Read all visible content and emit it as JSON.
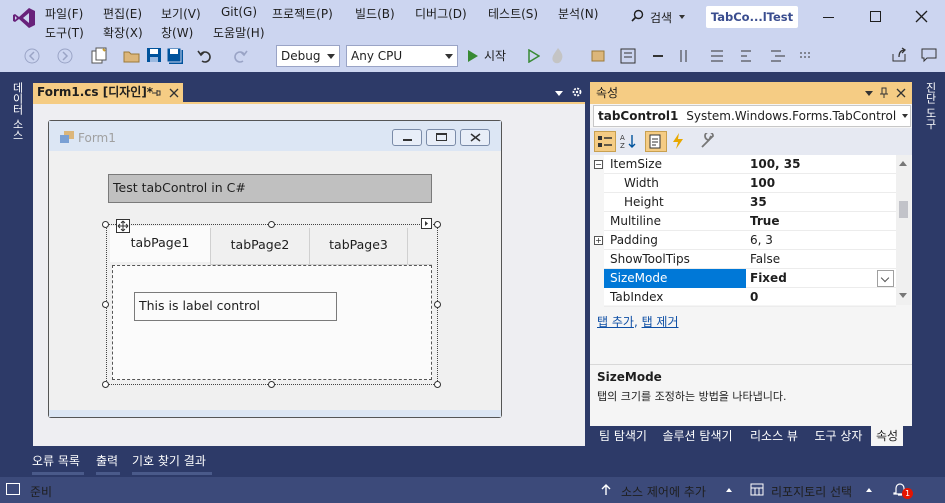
{
  "menu": {
    "row1": [
      "파일(F)",
      "편집(E)",
      "보기(V)",
      "Git(G)",
      "프로젝트(P)",
      "빌드(B)",
      "디버그(D)",
      "테스트(S)",
      "분석(N)"
    ],
    "row2": [
      "도구(T)",
      "확장(X)",
      "창(W)",
      "도움말(H)"
    ],
    "search": "검색",
    "window_title": "TabCo...lTest"
  },
  "toolbar": {
    "config": "Debug",
    "platform": "Any CPU",
    "start_label": "시작"
  },
  "left_strip": "데이터 소스",
  "right_strip": "진단 도구",
  "document": {
    "tab_label": "Form1.cs [디자인]*"
  },
  "form": {
    "title": "Form1",
    "label1": "Test tabControl in C#",
    "tabs": [
      "tabPage1",
      "tabPage2",
      "tabPage3"
    ],
    "label2": "This is label control"
  },
  "properties": {
    "header": "속성",
    "object_name": "tabControl1",
    "object_type": "System.Windows.Forms.TabControl",
    "rows": [
      {
        "name": "ItemSize",
        "value": "100, 35",
        "bold": true,
        "expander": "−"
      },
      {
        "name": "Width",
        "value": "100",
        "bold": true,
        "sub": true
      },
      {
        "name": "Height",
        "value": "35",
        "bold": true,
        "sub": true
      },
      {
        "name": "Multiline",
        "value": "True",
        "bold": true
      },
      {
        "name": "Padding",
        "value": "6, 3",
        "bold": false,
        "expander": "+"
      },
      {
        "name": "ShowToolTips",
        "value": "False",
        "bold": false
      },
      {
        "name": "SizeMode",
        "value": "Fixed",
        "bold": true,
        "selected": true
      },
      {
        "name": "TabIndex",
        "value": "0",
        "bold": true
      }
    ],
    "commands": [
      "탭 추가",
      "탭 제거"
    ],
    "desc_title": "SizeMode",
    "desc_text": "탭의 크기를 조정하는 방법을 나타냅니다."
  },
  "panel_tabs": [
    "팀 탐색기",
    "솔루션 탐색기",
    "리소스 뷰",
    "도구 상자",
    "속성"
  ],
  "output_tabs": [
    "오류 목록",
    "출력",
    "기호 찾기 결과"
  ],
  "status": {
    "ready": "준비",
    "source_control": "소스 제어에 추가",
    "repository": "리포지토리 선택",
    "notifications": "1"
  },
  "colors": {
    "accent": "#f5cc84",
    "selection": "#0078d7",
    "chrome": "#ccd5f0",
    "background": "#2d3a68"
  }
}
